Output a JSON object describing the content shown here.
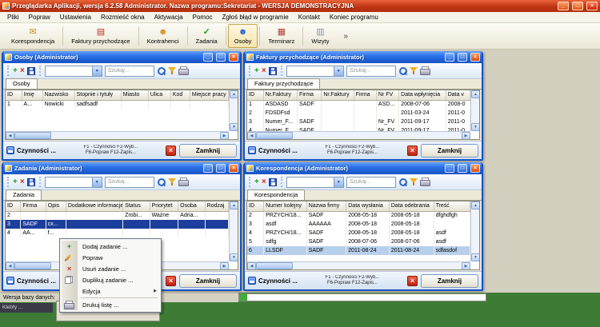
{
  "app": {
    "title": "Przeglądarka Aplikacji, wersja 6.2.58 Administrator. Nazwa programu:Sekretariat - WERSJA DEMONSTRACYJNA",
    "menu_items": [
      "Pliki",
      "Popraw",
      "Ustawienia",
      "Rozmieść okna",
      "Aktywacja",
      "Pomoc",
      "Zgłoś błąd w programie",
      "Kontakt",
      "Koniec programu"
    ],
    "toolbar_items": [
      "Korespondencja",
      "Faktury przychodzące",
      "Kontrahenci",
      "Zadania",
      "Osoby",
      "Terminarz",
      "Wizyty"
    ],
    "toolbar_overflow": "»"
  },
  "chrome": {
    "search_placeholder": "Szukaj...",
    "actions_label": "Czynności ...",
    "hint_line1": "F1 - Czynności F2-Wyb...",
    "hint_line2": "F6-Popraw F12-Zapis...",
    "close_label": "Zamknij"
  },
  "windows": {
    "osoby": {
      "title": "Osoby  (Administrator)",
      "tab": "Osoby",
      "columns": [
        "ID",
        "Imię",
        "Nazwisko",
        "Stopnie i tytuły",
        "Miasto",
        "Ulica",
        "Kod",
        "Miejsce pracy"
      ],
      "rows": [
        [
          "1",
          "A...",
          "Nowicki",
          "sadfsadf",
          "",
          "",
          "",
          ""
        ]
      ],
      "selected_row": -1,
      "selected_class": "dark"
    },
    "faktury": {
      "title": "Faktury przychodzące (Administrator)",
      "tab": "Faktury przychodzące",
      "columns": [
        "ID",
        "Nr.Faktury",
        "Firma",
        "Nr.Faktury",
        "Firma",
        "Nr FV",
        "Data wpłynięcia",
        "Data v"
      ],
      "rows": [
        [
          "1",
          "ASDASD",
          "SADF",
          "",
          "",
          "ASD...",
          "2008-07-06",
          "2008-0"
        ],
        [
          "2",
          "FDSDFsd",
          "",
          "",
          "",
          "",
          "2011-03-24",
          "2011-0"
        ],
        [
          "3",
          "Numer_F...",
          "SADF",
          "",
          "",
          "Nr_FV",
          "2011-09-17",
          "2011-0"
        ],
        [
          "4",
          "Numer_F...",
          "SADF",
          "",
          "",
          "Nr_FV",
          "2011-09-17",
          "2011-0"
        ]
      ],
      "selected_row": -1,
      "selected_class": "dark"
    },
    "zadania": {
      "title": "Zadania  (Administrator)",
      "tab": "Zadania",
      "columns": [
        "ID",
        "Firma",
        "Opis",
        "Dodatkowe informacje",
        "Status",
        "Priorytet",
        "Osoba",
        "Rodzaj"
      ],
      "rows": [
        [
          "2",
          "",
          "",
          "",
          "Zrobi...",
          "Ważne",
          "Adria...",
          ""
        ],
        [
          "3",
          "SADF",
          "cx...",
          "",
          "",
          "",
          "",
          ""
        ],
        [
          "4",
          "AA...",
          "f...",
          "",
          "",
          "",
          "",
          ""
        ]
      ],
      "selected_row": 1,
      "selected_class": "dark"
    },
    "korespondencja": {
      "title": "Korespondencja (Administrator)",
      "tab": "Korespondencja",
      "columns": [
        "ID",
        "Numer kolejny",
        "Nazwa firmy",
        "Data wysłania",
        "Data odebrania",
        "Treść"
      ],
      "rows": [
        [
          "2",
          "PRZYCH/18...",
          "SADF",
          "2008-05-18",
          "2008-05-18",
          "dfghdfgh"
        ],
        [
          "3",
          "asdf",
          "AAAAAA",
          "2008-05-18",
          "2008-05-18",
          ""
        ],
        [
          "4",
          "PRZYCH/18...",
          "SADF",
          "2008-05-18",
          "2008-05-18",
          "asdf"
        ],
        [
          "5",
          "sdfg",
          "SADF",
          "2008-07-06",
          "2008-07-06",
          "asdf"
        ],
        [
          "6",
          "LLSDF",
          "SADF",
          "2011-08-24",
          "2011-08-24",
          "sdfasdof"
        ]
      ],
      "selected_row": 4,
      "selected_class": "light"
    }
  },
  "context_menu": {
    "items": [
      {
        "label": "Dodaj zadanie ...",
        "icon": "add"
      },
      {
        "label": "Popraw",
        "icon": "pencil"
      },
      {
        "label": "Usuń zadanie ...",
        "icon": "delete"
      },
      {
        "label": "Duplikuj zadanie ...",
        "icon": "copy"
      },
      {
        "label": "Edycja",
        "icon": "submenu"
      },
      {
        "label": "Drukuj listę ...",
        "icon": "printer"
      }
    ]
  },
  "statusbar": {
    "left_text": "Wersja bazy danych:",
    "taskbar_text": "Klebfy ..."
  },
  "icons": {
    "add": "+",
    "delete": "×",
    "minimize": "_",
    "maximize": "□",
    "close": "×",
    "dropdown": "▼",
    "up": "▲",
    "down": "▼",
    "left": "◀",
    "right": "▶",
    "submenu": "▶",
    "envelope": "✉",
    "document": "▤",
    "people": "☻",
    "check": "✓",
    "person": "☻",
    "calendar": "▦",
    "card": "▥"
  },
  "colors": {
    "app_titlebar": "#c13514",
    "child_titlebar": "#2b71e8",
    "selection_dark": "#1c3e9c",
    "selection_light": "#b8cfec",
    "desktop_green": "#3e7c36"
  }
}
